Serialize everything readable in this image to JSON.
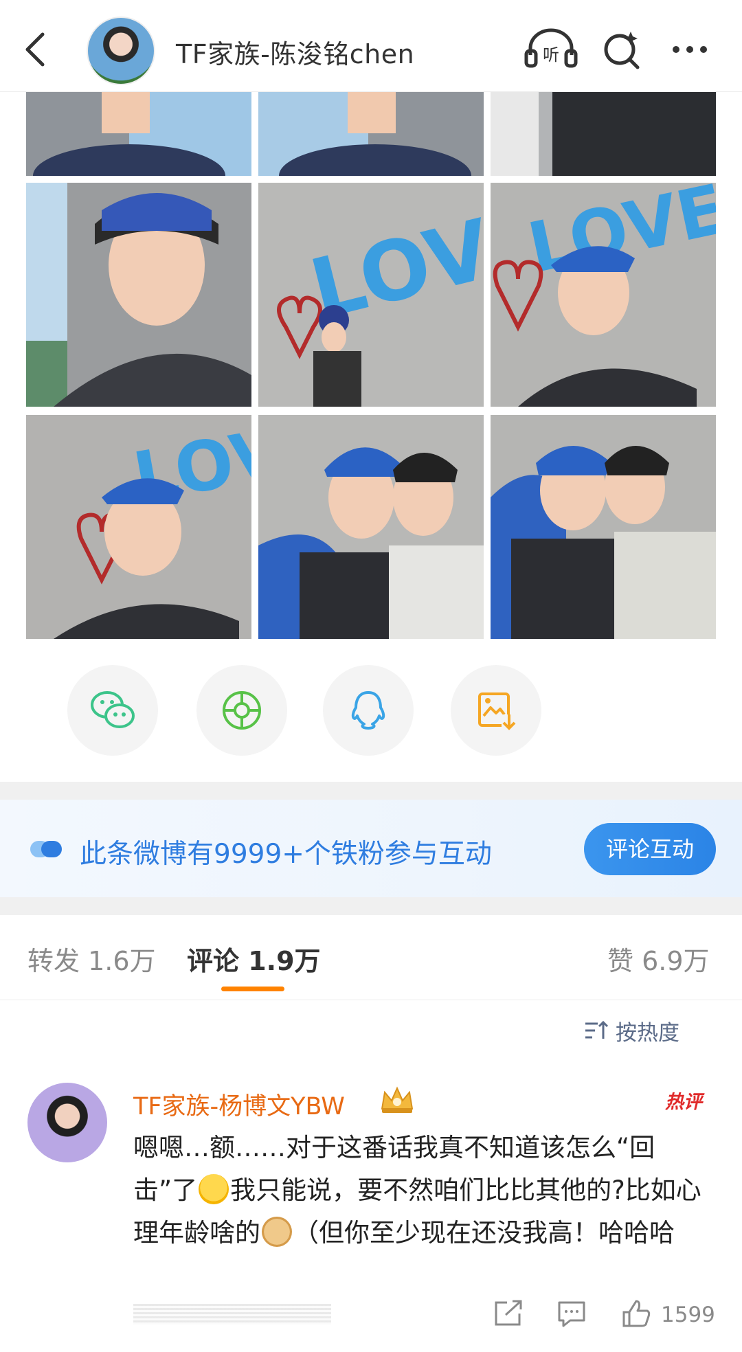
{
  "header": {
    "title": "TF家族-陈浚铭chen"
  },
  "share": {
    "wechat": "wechat-icon",
    "moments": "moments-icon",
    "qq": "qq-icon",
    "save": "save-image-icon"
  },
  "banner": {
    "text": "此条微博有9999+个铁粉参与互动",
    "button": "评论互动"
  },
  "tabs": {
    "repost": "转发 1.6万",
    "comment": "评论 1.9万",
    "like": "赞 6.9万"
  },
  "sort": {
    "label": "按热度"
  },
  "comment": {
    "author": "TF家族-杨博文YBW",
    "badge": "热评",
    "text_1": "嗯嗯…额……对于这番话我真不知道该怎么“回击”了",
    "text_2": "我只能说，要不然咱们比比其他的?比如心理年龄啥的",
    "text_3": "（但你至少现在还没我高！哈哈哈",
    "likes": "1599"
  },
  "colors": {
    "accent_orange": "#ff8200",
    "blue": "#2f7de0",
    "name_orange": "#e86a14"
  }
}
